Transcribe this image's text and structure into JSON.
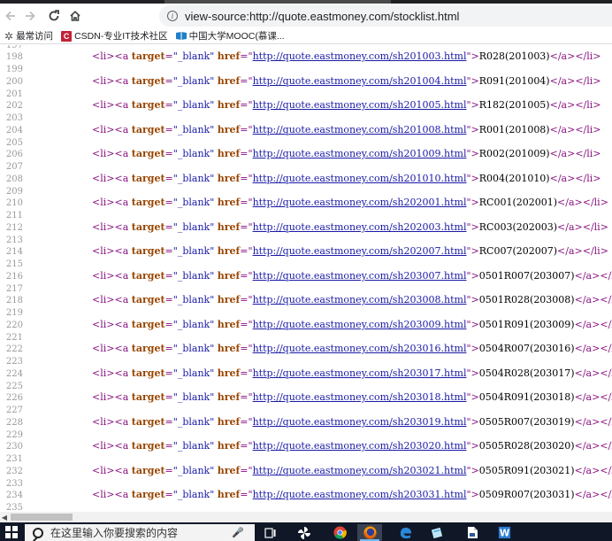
{
  "browser": {
    "back_icon": "back-arrow-icon",
    "forward_icon": "forward-arrow-icon",
    "reload_icon": "reload-icon",
    "home_icon": "home-icon",
    "address_url": "view-source:http://quote.eastmoney.com/stocklist.html"
  },
  "bookmarks": [
    {
      "label": "最常访问",
      "icon": "star-icon"
    },
    {
      "label": "CSDN-专业IT技术社区",
      "icon": "csdn-logo-icon"
    },
    {
      "label": "中国大学MOOC(慕课...",
      "icon": "mooc-logo-icon"
    }
  ],
  "source": {
    "lines": [
      {
        "num": "197"
      },
      {
        "num": "198",
        "href": "http://quote.eastmoney.com/sh201003.html",
        "text": "R028(201003)"
      },
      {
        "num": "199"
      },
      {
        "num": "200",
        "href": "http://quote.eastmoney.com/sh201004.html",
        "text": "R091(201004)"
      },
      {
        "num": "201"
      },
      {
        "num": "202",
        "href": "http://quote.eastmoney.com/sh201005.html",
        "text": "R182(201005)"
      },
      {
        "num": "203"
      },
      {
        "num": "204",
        "href": "http://quote.eastmoney.com/sh201008.html",
        "text": "R001(201008)"
      },
      {
        "num": "205"
      },
      {
        "num": "206",
        "href": "http://quote.eastmoney.com/sh201009.html",
        "text": "R002(201009)"
      },
      {
        "num": "207"
      },
      {
        "num": "208",
        "href": "http://quote.eastmoney.com/sh201010.html",
        "text": "R004(201010)"
      },
      {
        "num": "209"
      },
      {
        "num": "210",
        "href": "http://quote.eastmoney.com/sh202001.html",
        "text": "RC001(202001)"
      },
      {
        "num": "211"
      },
      {
        "num": "212",
        "href": "http://quote.eastmoney.com/sh202003.html",
        "text": "RC003(202003)"
      },
      {
        "num": "213"
      },
      {
        "num": "214",
        "href": "http://quote.eastmoney.com/sh202007.html",
        "text": "RC007(202007)"
      },
      {
        "num": "215"
      },
      {
        "num": "216",
        "href": "http://quote.eastmoney.com/sh203007.html",
        "text": "0501R007(203007)"
      },
      {
        "num": "217"
      },
      {
        "num": "218",
        "href": "http://quote.eastmoney.com/sh203008.html",
        "text": "0501R028(203008)"
      },
      {
        "num": "219"
      },
      {
        "num": "220",
        "href": "http://quote.eastmoney.com/sh203009.html",
        "text": "0501R091(203009)"
      },
      {
        "num": "221"
      },
      {
        "num": "222",
        "href": "http://quote.eastmoney.com/sh203016.html",
        "text": "0504R007(203016)"
      },
      {
        "num": "223"
      },
      {
        "num": "224",
        "href": "http://quote.eastmoney.com/sh203017.html",
        "text": "0504R028(203017)"
      },
      {
        "num": "225"
      },
      {
        "num": "226",
        "href": "http://quote.eastmoney.com/sh203018.html",
        "text": "0504R091(203018)"
      },
      {
        "num": "227"
      },
      {
        "num": "228",
        "href": "http://quote.eastmoney.com/sh203019.html",
        "text": "0505R007(203019)"
      },
      {
        "num": "229"
      },
      {
        "num": "230",
        "href": "http://quote.eastmoney.com/sh203020.html",
        "text": "0505R028(203020)"
      },
      {
        "num": "231"
      },
      {
        "num": "232",
        "href": "http://quote.eastmoney.com/sh203021.html",
        "text": "0505R091(203021)"
      },
      {
        "num": "233"
      },
      {
        "num": "234",
        "href": "http://quote.eastmoney.com/sh203031.html",
        "text": "0509R007(203031)"
      },
      {
        "num": "235"
      }
    ]
  },
  "code_tokens": {
    "li_open": "<li>",
    "a_open": "<a",
    "target_attr": "target",
    "target_value": "\"_blank\"",
    "href_attr": "href",
    "a_close": "</a>",
    "li_close": "</li>"
  },
  "taskbar": {
    "search_placeholder": "在这里输入你要搜索的内容",
    "icons": [
      "windows-start-icon",
      "microphone-icon",
      "task-view-icon",
      "pinwheel-app-icon",
      "chrome-icon",
      "firefox-icon",
      "edge-icon",
      "notes-app-icon",
      "file-app-icon",
      "word-icon"
    ]
  },
  "colors": {
    "tag": "#881280",
    "attribute": "#994500",
    "value": "#1a1aa6",
    "line_number": "#9a9a9a",
    "taskbar": "#101828"
  }
}
